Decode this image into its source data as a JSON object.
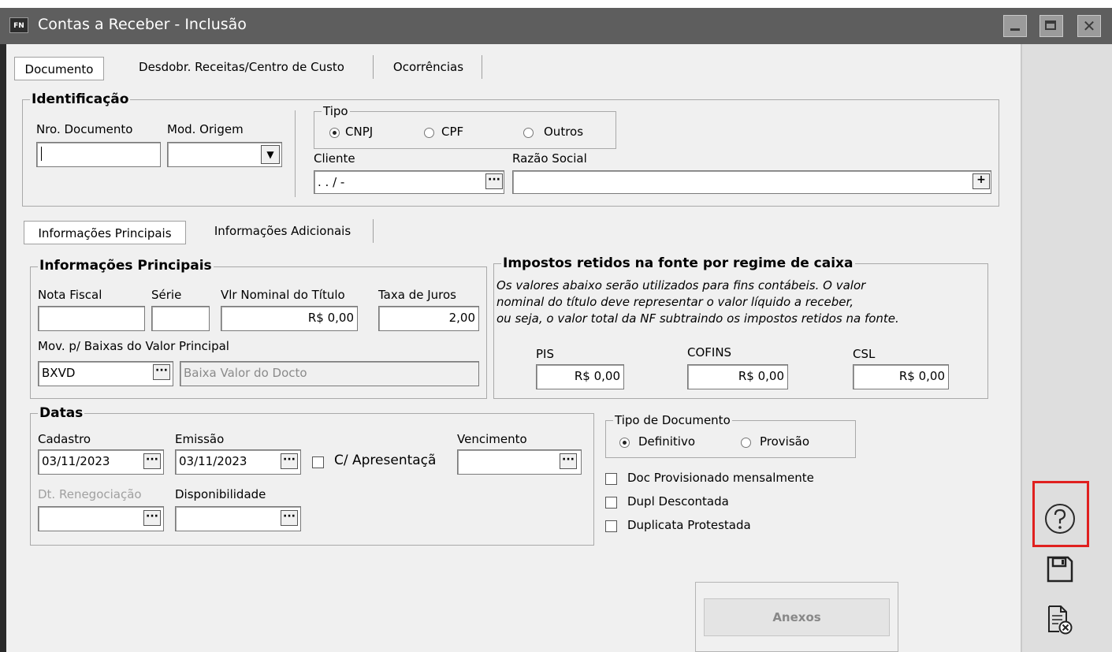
{
  "window": {
    "title": "Contas a Receber - Inclusão",
    "app_badge": "FN",
    "close_glyph": "✕"
  },
  "tabs": [
    "Documento",
    "Desdobr. Receitas/Centro de Custo",
    "Ocorrências"
  ],
  "identificacao": {
    "title": "Identificação",
    "nro_documento_label": "Nro. Documento",
    "nro_documento_value": "",
    "mod_origem_label": "Mod. Origem",
    "mod_origem_value": "",
    "tipo": {
      "title": "Tipo",
      "options": [
        "CNPJ",
        "CPF",
        "Outros"
      ],
      "selected": "CNPJ"
    },
    "cliente_label": "Cliente",
    "cliente_value": ". . / -",
    "razao_social_label": "Razão Social",
    "razao_social_value": ""
  },
  "subtabs": [
    "Informações Principais",
    "Informações Adicionais"
  ],
  "info_principais": {
    "title": "Informações Principais",
    "nota_fiscal_label": "Nota Fiscal",
    "nota_fiscal_value": "",
    "serie_label": "Série",
    "serie_value": "",
    "vlr_nominal_label": "Vlr Nominal do Título",
    "vlr_nominal_value": "R$ 0,00",
    "taxa_juros_label": "Taxa de Juros",
    "taxa_juros_value": "2,00",
    "mov_baixas_label": "Mov. p/ Baixas do Valor Principal",
    "mov_baixas_code": "BXVD",
    "mov_baixas_desc": "Baixa Valor do Docto"
  },
  "impostos": {
    "title": "Impostos retidos na fonte por regime de caixa",
    "note_lines": [
      "Os valores abaixo serão utilizados para fins contábeis. O valor",
      "nominal do título deve representar o valor líquido a receber,",
      "ou seja, o valor total da NF subtraindo os impostos retidos na fonte."
    ],
    "pis_label": "PIS",
    "pis_value": "R$ 0,00",
    "cofins_label": "COFINS",
    "cofins_value": "R$ 0,00",
    "csl_label": "CSL",
    "csl_value": "R$ 0,00"
  },
  "datas": {
    "title": "Datas",
    "cadastro_label": "Cadastro",
    "cadastro_value": "03/11/2023",
    "emissao_label": "Emissão",
    "emissao_value": "03/11/2023",
    "c_apresentacao_label": "C/ Apresentaçã",
    "vencimento_label": "Vencimento",
    "vencimento_value": "",
    "dt_renegociacao_label": "Dt. Renegociação",
    "dt_renegociacao_value": "",
    "disponibilidade_label": "Disponibilidade",
    "disponibilidade_value": ""
  },
  "tipo_documento": {
    "title": "Tipo de Documento",
    "options": [
      "Definitivo",
      "Provisão"
    ],
    "selected": "Definitivo"
  },
  "checkboxes": [
    "Doc Provisionado mensalmente",
    "Dupl Descontada",
    "Duplicata Protestada"
  ],
  "buttons": {
    "anexos": "Anexos",
    "ellipsis": "···",
    "dropdown_arrow": "▼",
    "plus": "+"
  },
  "side_toolbar": {
    "help_icon": "help-icon",
    "save_icon": "save-icon",
    "cancel_icon": "cancel-document-icon",
    "highlight_color": "#e0201f"
  }
}
